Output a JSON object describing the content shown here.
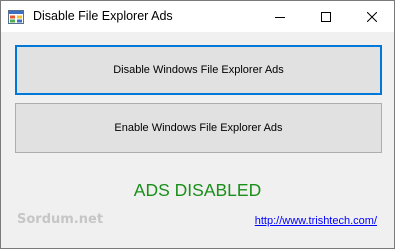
{
  "window": {
    "title": "Disable File Explorer Ads",
    "icon": "app-window-icon"
  },
  "buttons": {
    "disable_label": "Disable Windows File Explorer Ads",
    "enable_label": "Enable Windows File Explorer Ads"
  },
  "status": {
    "text": "ADS DISABLED",
    "color": "#1a8f1a"
  },
  "footer": {
    "brand": "Sordum.net",
    "link": "http://www.trishtech.com/"
  },
  "colors": {
    "accent": "#0078d7",
    "link": "#0000ff"
  }
}
